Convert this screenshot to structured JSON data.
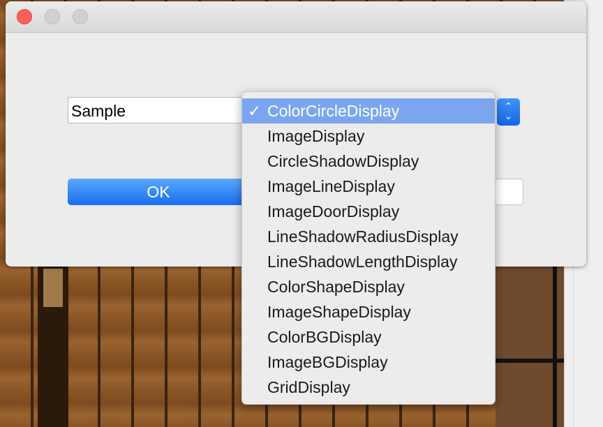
{
  "window": {
    "text_field_value": "Sample",
    "ok_label": "OK",
    "popup_arrows": "⌃⌄"
  },
  "menu": {
    "checkmark": "✓",
    "selected_index": 0,
    "items": [
      "ColorCircleDisplay",
      "ImageDisplay",
      "CircleShadowDisplay",
      "ImageLineDisplay",
      "ImageDoorDisplay",
      "LineShadowRadiusDisplay",
      "LineShadowLengthDisplay",
      "ColorShapeDisplay",
      "ImageShapeDisplay",
      "ColorBGDisplay",
      "ImageBGDisplay",
      "GridDisplay"
    ]
  },
  "colors": {
    "accent": "#1a6ef0",
    "menu_highlight": "#7ba6ef",
    "close_button": "#fc5f57"
  }
}
